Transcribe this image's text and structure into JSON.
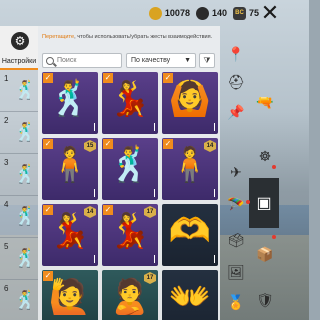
{
  "currency": {
    "coins": "10078",
    "gems": "140",
    "bc": "75"
  },
  "close_symbol": "✕",
  "settings": {
    "label": "Настройки"
  },
  "slots": [
    {
      "num": "1"
    },
    {
      "num": "2"
    },
    {
      "num": "3"
    },
    {
      "num": "4"
    },
    {
      "num": "5"
    },
    {
      "num": "6"
    }
  ],
  "hint": {
    "accent": "Перетащите",
    "rest": ", чтобы использовать/убрать жесты взаимодействия."
  },
  "search": {
    "placeholder": "Поиск"
  },
  "sort": {
    "label": "По качеству"
  },
  "cards": [
    {
      "checked": true,
      "level": ""
    },
    {
      "checked": true,
      "level": ""
    },
    {
      "checked": true,
      "level": ""
    },
    {
      "checked": true,
      "level": "15"
    },
    {
      "checked": true,
      "level": ""
    },
    {
      "checked": true,
      "level": "14"
    },
    {
      "checked": true,
      "level": "14"
    },
    {
      "checked": true,
      "level": "17"
    },
    {
      "checked": false,
      "level": ""
    },
    {
      "checked": true,
      "level": ""
    },
    {
      "checked": false,
      "level": "17"
    },
    {
      "checked": false,
      "level": ""
    }
  ],
  "colors": {
    "accent": "#f08c1d",
    "card_purple": "#5a3f8a"
  }
}
